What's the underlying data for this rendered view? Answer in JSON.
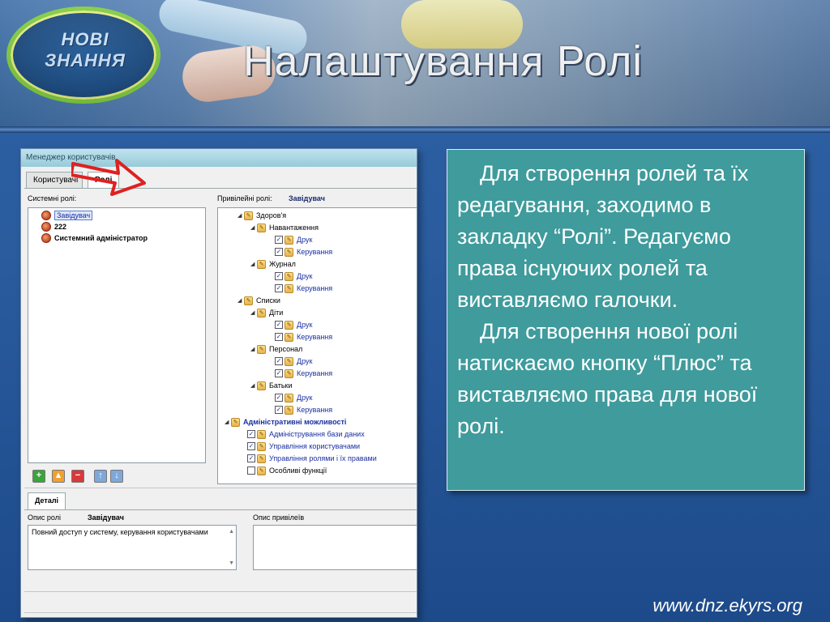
{
  "slide": {
    "title": "Налаштування Ролі",
    "logo_line1": "НОВІ",
    "logo_line2": "ЗНАННЯ",
    "footer_url": "www.dnz.ekyrs.org",
    "accent_color": "#3f9b9c",
    "paragraph1": "Для створення ролей та їх редагування, заходимо в закладку “Ролі”. Редагуємо права існуючих ролей та виставляємо галочки.",
    "paragraph2": "Для створення нової ролі натискаємо кнопку “Плюс” та виставляємо права для нової ролі."
  },
  "window": {
    "title": "Менеджер користувачів",
    "tabs": [
      {
        "label": "Користувачі",
        "active": false
      },
      {
        "label": "Ролі",
        "active": true
      }
    ],
    "system_roles_label": "Системні ролі:",
    "system_roles": [
      {
        "label": "Завідувач",
        "selected": true
      },
      {
        "label": "222",
        "selected": false
      },
      {
        "label": "Системний адміністратор",
        "selected": false
      }
    ],
    "privileges_label": "Привілейні ролі:",
    "privileges_role": "Завідувач",
    "tree": {
      "group1": "Здоров'я",
      "load": "Навантаження",
      "print": "Друк",
      "manage": "Керування",
      "journal": "Журнал",
      "lists": "Списки",
      "children": "Діти",
      "staff": "Персонал",
      "parents": "Батьки",
      "admin": "Адміністративні можливості",
      "admin_items": [
        {
          "label": "Адміністрування бази даних",
          "checked": true
        },
        {
          "label": "Управління користувачами",
          "checked": true
        },
        {
          "label": "Управління ролями і їх правами",
          "checked": true
        },
        {
          "label": "Особливі функції",
          "checked": false
        }
      ]
    },
    "toolbar_icons": [
      "add-icon",
      "edit-icon",
      "delete-icon",
      "move-up-icon",
      "move-down-icon"
    ],
    "details_tab": "Деталі",
    "role_desc_label": "Опис ролі",
    "role_desc_name": "Завідувач",
    "role_desc_text": "Повний доступ у систему, керування користувачами",
    "priv_desc_label": "Опис привілеїв",
    "checkmark": "✓"
  }
}
